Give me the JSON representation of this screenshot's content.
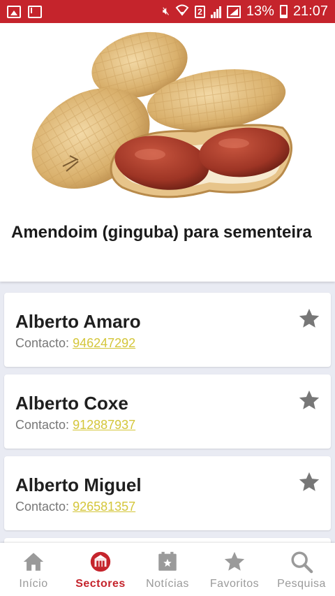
{
  "status_bar": {
    "battery": "13%",
    "time": "21:07",
    "sim_slot": "2"
  },
  "product": {
    "title": "Amendoim (ginguba) para sementeira"
  },
  "contacts": [
    {
      "name": "Alberto Amaro",
      "contact_label": "Contacto:",
      "phone": "946247292"
    },
    {
      "name": "Alberto Coxe",
      "contact_label": "Contacto:",
      "phone": "912887937"
    },
    {
      "name": "Alberto Miguel",
      "contact_label": "Contacto:",
      "phone": "926581357"
    }
  ],
  "bottom_nav": {
    "items": [
      {
        "label": "Início",
        "icon": "home-icon"
      },
      {
        "label": "Sectores",
        "icon": "sectors-icon",
        "active": true
      },
      {
        "label": "Notícias",
        "icon": "news-icon"
      },
      {
        "label": "Favoritos",
        "icon": "star-icon"
      },
      {
        "label": "Pesquisa",
        "icon": "search-icon"
      }
    ]
  },
  "colors": {
    "brand": "#c5242c",
    "phone_link": "#d4c63a",
    "inactive_nav": "#9a9a9a"
  }
}
